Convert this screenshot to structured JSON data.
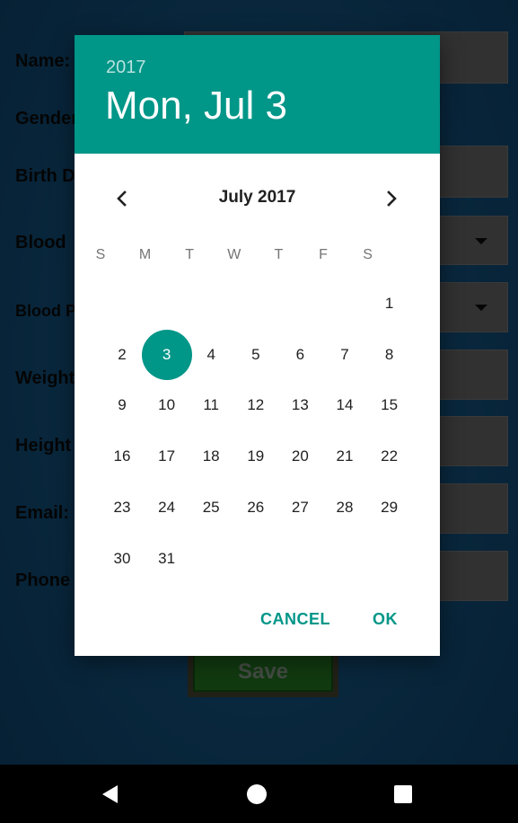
{
  "form": {
    "labels": {
      "name": "Name:",
      "gender": "Gender",
      "birth_date": "Birth D",
      "blood_type": "Blood",
      "blood_pressure": "Blood P",
      "weight": "Weight",
      "height": "Height",
      "email": "Email:",
      "phone": "Phone"
    },
    "save_label": "Save"
  },
  "dialog": {
    "header_year": "2017",
    "header_date": "Mon, Jul 3",
    "month_title": "July 2017",
    "weekdays": [
      "S",
      "M",
      "T",
      "W",
      "T",
      "F",
      "S"
    ],
    "weeks": [
      [
        "",
        "",
        "",
        "",
        "",
        "",
        "1"
      ],
      [
        "2",
        "3",
        "4",
        "5",
        "6",
        "7",
        "8"
      ],
      [
        "9",
        "10",
        "11",
        "12",
        "13",
        "14",
        "15"
      ],
      [
        "16",
        "17",
        "18",
        "19",
        "20",
        "21",
        "22"
      ],
      [
        "23",
        "24",
        "25",
        "26",
        "27",
        "28",
        "29"
      ],
      [
        "30",
        "31",
        "",
        "",
        "",
        "",
        ""
      ]
    ],
    "selected_day": "3",
    "cancel_label": "CANCEL",
    "ok_label": "OK"
  },
  "colors": {
    "accent": "#009688",
    "background": "#134a72",
    "field": "#5a5a5a",
    "save_button": "#1f6b1e"
  },
  "icons": {
    "prev": "chevron-left-icon",
    "next": "chevron-right-icon",
    "dropdown": "caret-down-icon",
    "back": "back-triangle-icon",
    "home": "home-circle-icon",
    "recents": "recents-square-icon"
  }
}
